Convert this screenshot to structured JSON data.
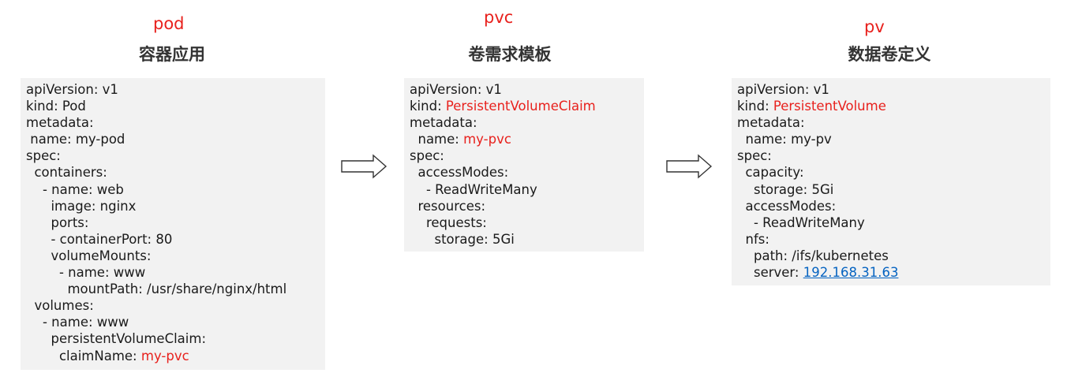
{
  "columns": [
    {
      "tag": "pod",
      "title": "容器应用",
      "lines": [
        {
          "text": "apiVersion: v1"
        },
        {
          "text": "kind: Pod"
        },
        {
          "text": "metadata:"
        },
        {
          "text": " name: my-pod"
        },
        {
          "text": "spec:"
        },
        {
          "text": "  containers:"
        },
        {
          "text": "    - name: web"
        },
        {
          "text": "      image: nginx"
        },
        {
          "text": "      ports:"
        },
        {
          "text": "      - containerPort: 80"
        },
        {
          "text": "      volumeMounts:"
        },
        {
          "text": "        - name: www"
        },
        {
          "text": "          mountPath: /usr/share/nginx/html"
        },
        {
          "text": "  volumes:"
        },
        {
          "text": "    - name: www"
        },
        {
          "text": "      persistentVolumeClaim:"
        },
        {
          "text": "        claimName: ",
          "value": "my-pvc",
          "style": "red"
        }
      ]
    },
    {
      "tag": "pvc",
      "title": "卷需求模板",
      "lines": [
        {
          "text": "apiVersion: v1"
        },
        {
          "text": "kind: ",
          "value": "PersistentVolumeClaim",
          "style": "red"
        },
        {
          "text": "metadata:"
        },
        {
          "text": "  name: ",
          "value": "my-pvc",
          "style": "red"
        },
        {
          "text": "spec:"
        },
        {
          "text": "  accessModes:"
        },
        {
          "text": "    - ReadWriteMany"
        },
        {
          "text": "  resources:"
        },
        {
          "text": "    requests:"
        },
        {
          "text": "      storage: 5Gi"
        }
      ]
    },
    {
      "tag": "pv",
      "title": "数据卷定义",
      "lines": [
        {
          "text": "apiVersion: v1"
        },
        {
          "text": "kind: ",
          "value": "PersistentVolume",
          "style": "red"
        },
        {
          "text": "metadata:"
        },
        {
          "text": "  name: my-pv"
        },
        {
          "text": "spec:"
        },
        {
          "text": "  capacity:"
        },
        {
          "text": "    storage: 5Gi"
        },
        {
          "text": "  accessModes:"
        },
        {
          "text": "    - ReadWriteMany"
        },
        {
          "text": "  nfs:"
        },
        {
          "text": "    path: /ifs/kubernetes"
        },
        {
          "text": "    server: ",
          "value": "192.168.31.63",
          "style": "link"
        }
      ]
    }
  ],
  "colors": {
    "highlight": "#e8211d",
    "link": "#0563c1",
    "panel": "#f2f2f2",
    "title": "#333333"
  }
}
